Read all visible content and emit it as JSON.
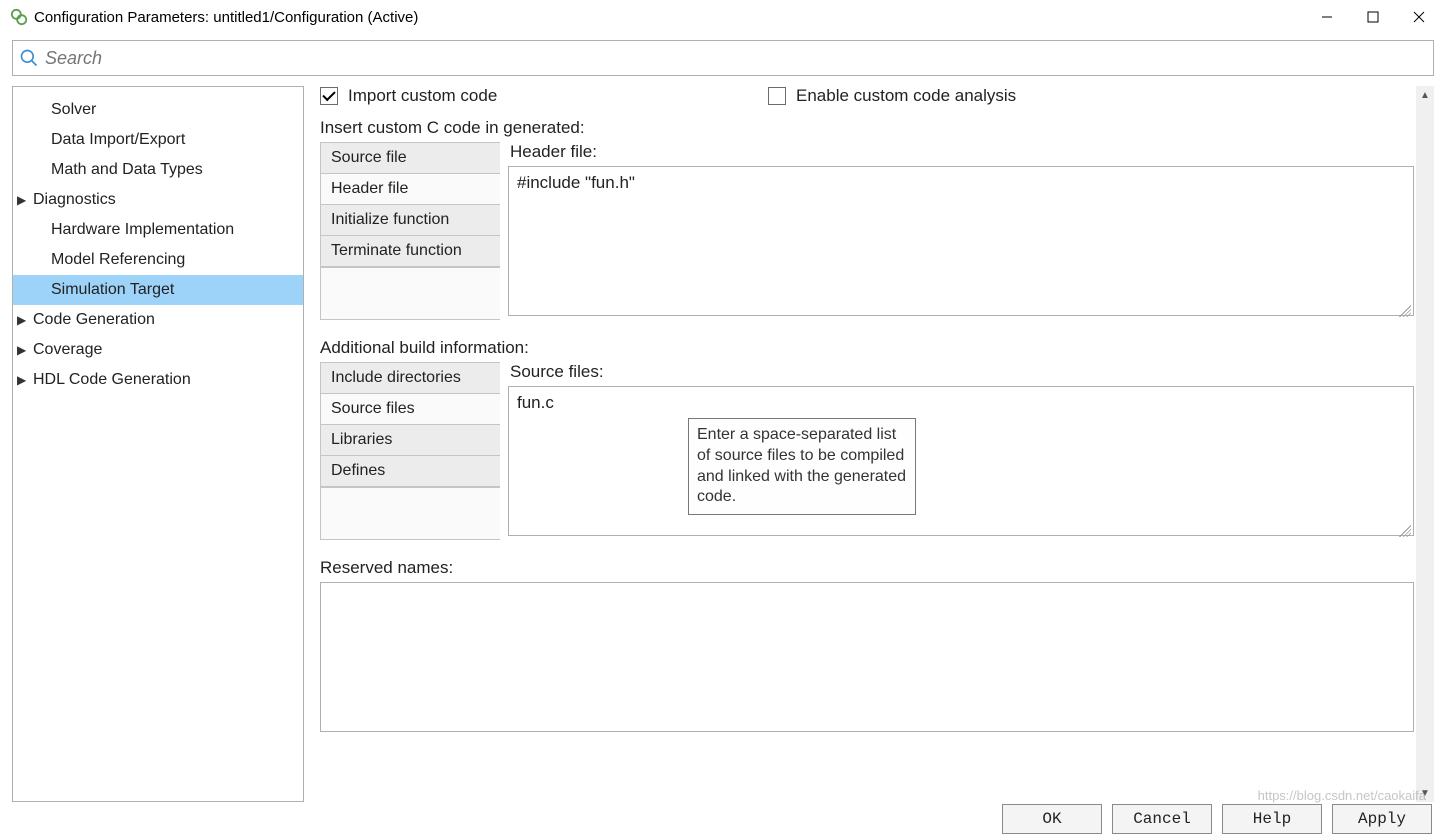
{
  "window": {
    "title": "Configuration Parameters: untitled1/Configuration (Active)"
  },
  "search": {
    "placeholder": "Search"
  },
  "sidebar": {
    "items": [
      {
        "label": "Solver",
        "expandable": false,
        "indent": true
      },
      {
        "label": "Data Import/Export",
        "expandable": false,
        "indent": true
      },
      {
        "label": "Math and Data Types",
        "expandable": false,
        "indent": true
      },
      {
        "label": "Diagnostics",
        "expandable": true,
        "indent": false
      },
      {
        "label": "Hardware Implementation",
        "expandable": false,
        "indent": true
      },
      {
        "label": "Model Referencing",
        "expandable": false,
        "indent": true
      },
      {
        "label": "Simulation Target",
        "expandable": false,
        "indent": true,
        "selected": true
      },
      {
        "label": "Code Generation",
        "expandable": true,
        "indent": false
      },
      {
        "label": "Coverage",
        "expandable": true,
        "indent": false
      },
      {
        "label": "HDL Code Generation",
        "expandable": true,
        "indent": false
      }
    ]
  },
  "content": {
    "import_custom_code": {
      "label": "Import custom code",
      "checked": true
    },
    "enable_analysis": {
      "label": "Enable custom code analysis",
      "checked": false
    },
    "insert_section_label": "Insert custom C code in generated:",
    "insert_tabs": [
      "Source file",
      "Header file",
      "Initialize function",
      "Terminate function"
    ],
    "insert_selected_tab": "Header file",
    "header_file_label": "Header file:",
    "header_file_value": "#include \"fun.h\"",
    "additional_section_label": "Additional build information:",
    "additional_tabs": [
      "Include directories",
      "Source files",
      "Libraries",
      "Defines"
    ],
    "additional_selected_tab": "Source files",
    "source_files_label": "Source files:",
    "source_files_value": "fun.c",
    "source_files_tooltip": "Enter a space-separated list of source files to be compiled and linked with the generated code.",
    "reserved_label": "Reserved names:",
    "reserved_value": ""
  },
  "footer": {
    "ok": "OK",
    "cancel": "Cancel",
    "help": "Help",
    "apply": "Apply"
  },
  "watermark": "https://blog.csdn.net/caokaifa"
}
